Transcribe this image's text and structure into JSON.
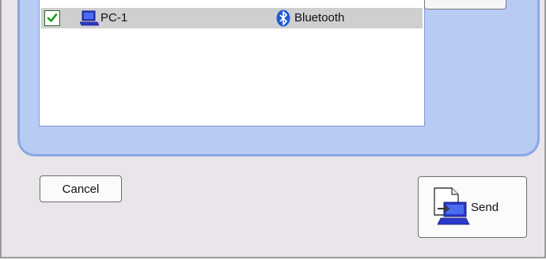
{
  "device_list": {
    "rows": [
      {
        "checked": true,
        "device_name": "PC-1",
        "connection": "Bluetooth",
        "device_icon": "computer-icon",
        "connection_icon": "bluetooth-icon"
      }
    ]
  },
  "actions": {
    "cancel_label": "Cancel",
    "send_label": "Send",
    "send_icon": "send-file-icon"
  },
  "colors": {
    "panel_background": "#b7cbf3",
    "panel_border": "#8aa8e6",
    "selected_row": "#cfcfd2",
    "dialog_background": "#e9e5ea"
  }
}
